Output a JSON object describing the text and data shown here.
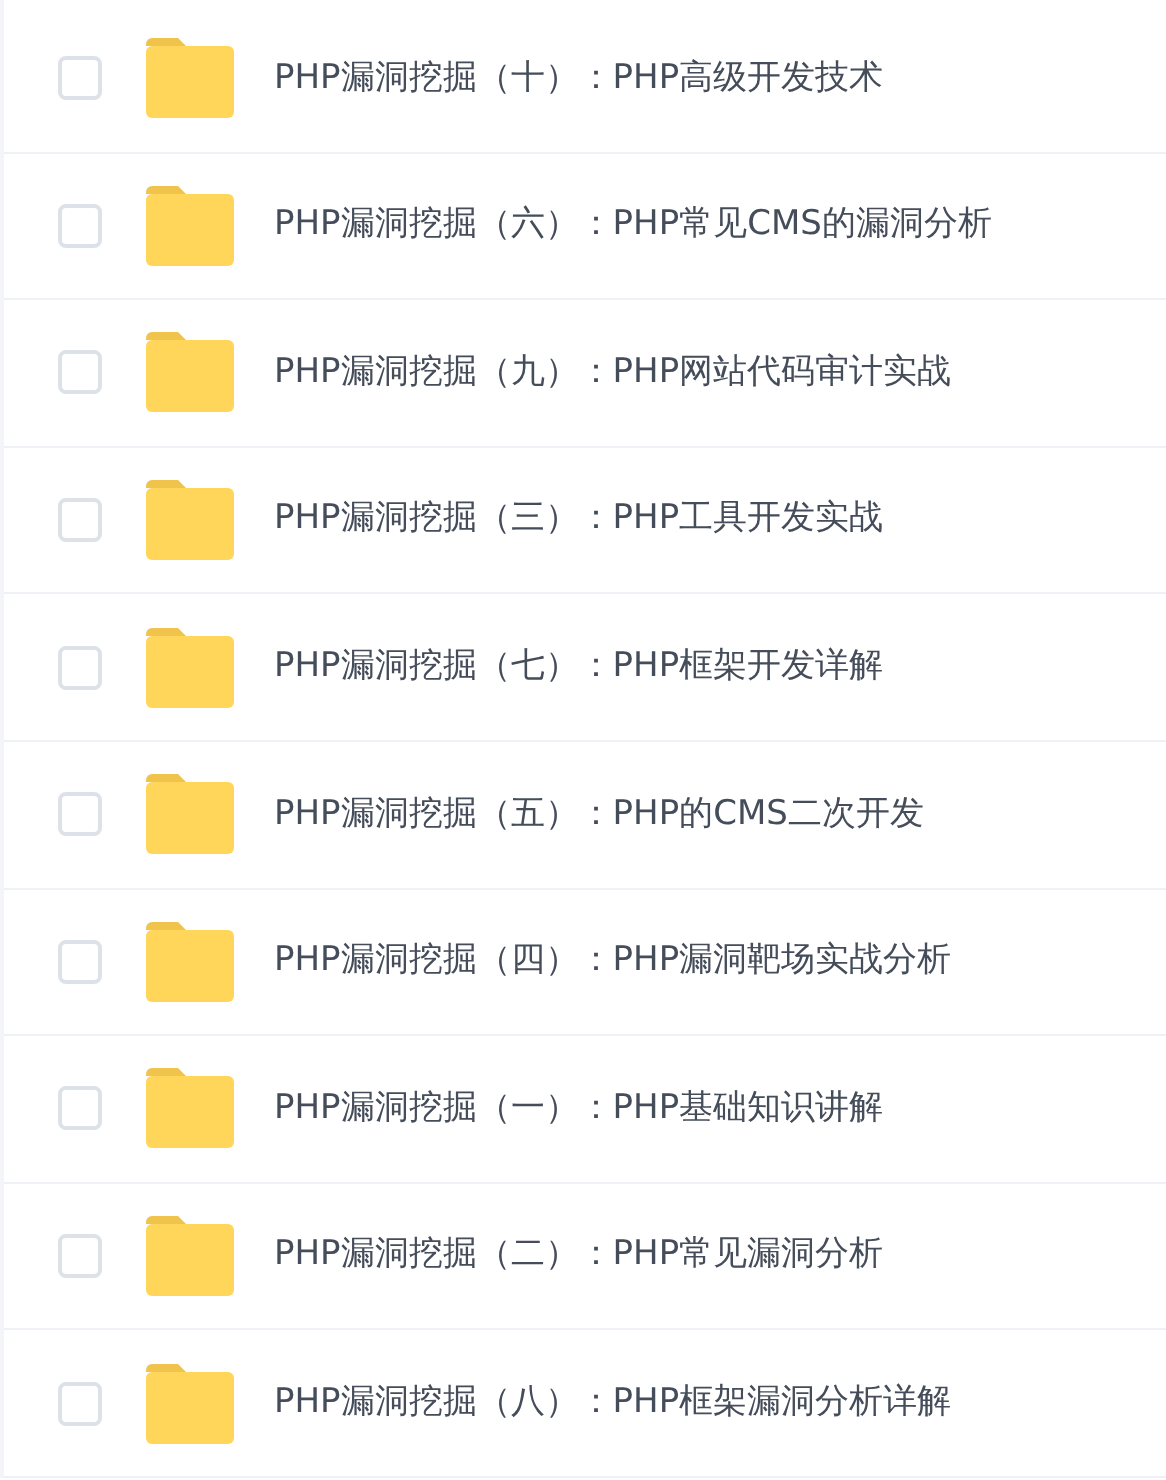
{
  "folders": [
    {
      "name": "PHP漏洞挖掘（十）：PHP高级开发技术",
      "checked": false
    },
    {
      "name": "PHP漏洞挖掘（六）：PHP常见CMS的漏洞分析",
      "checked": false
    },
    {
      "name": "PHP漏洞挖掘（九）：PHP网站代码审计实战",
      "checked": false
    },
    {
      "name": "PHP漏洞挖掘（三）：PHP工具开发实战",
      "checked": false
    },
    {
      "name": "PHP漏洞挖掘（七）：PHP框架开发详解",
      "checked": false
    },
    {
      "name": "PHP漏洞挖掘（五）：PHP的CMS二次开发",
      "checked": false
    },
    {
      "name": "PHP漏洞挖掘（四）：PHP漏洞靶场实战分析",
      "checked": false
    },
    {
      "name": "PHP漏洞挖掘（一）：PHP基础知识讲解",
      "checked": false
    },
    {
      "name": "PHP漏洞挖掘（二）：PHP常见漏洞分析",
      "checked": false
    },
    {
      "name": "PHP漏洞挖掘（八）：PHP框架漏洞分析详解",
      "checked": false
    }
  ]
}
